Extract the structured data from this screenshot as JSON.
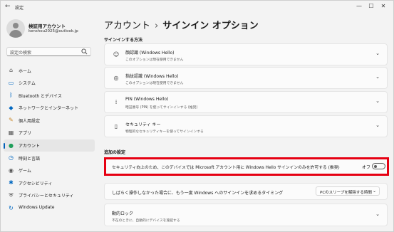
{
  "titlebar": {
    "back": "←",
    "title": "設定",
    "minimize": "—",
    "maximize": "☐",
    "close": "✕"
  },
  "profile": {
    "name": "検証用アカウント",
    "email": "kenshou2025@outlook.jp"
  },
  "search": {
    "placeholder": "設定の検索"
  },
  "nav": [
    {
      "label": "ホーム",
      "icon": "home-icon",
      "glyph": "⌂",
      "color": "#555555"
    },
    {
      "label": "システム",
      "icon": "monitor-icon",
      "glyph": "▭",
      "color": "#0067c0"
    },
    {
      "label": "Bluetooth とデバイス",
      "icon": "bluetooth-icon",
      "glyph": "ᛒ",
      "color": "#0067c0"
    },
    {
      "label": "ネットワークとインターネット",
      "icon": "wifi-icon",
      "glyph": "◆",
      "color": "#0067c0"
    },
    {
      "label": "個人用設定",
      "icon": "brush-icon",
      "glyph": "✎",
      "color": "#c98a2e"
    },
    {
      "label": "アプリ",
      "icon": "apps-icon",
      "glyph": "▦",
      "color": "#555555"
    },
    {
      "label": "アカウント",
      "icon": "account-icon",
      "glyph": "●",
      "color": "#1f9e5a"
    },
    {
      "label": "時刻と言語",
      "icon": "time-language-icon",
      "glyph": "◷",
      "color": "#0067c0"
    },
    {
      "label": "ゲーム",
      "icon": "game-icon",
      "glyph": "◉",
      "color": "#555555"
    },
    {
      "label": "アクセシビリティ",
      "icon": "accessibility-icon",
      "glyph": "✱",
      "color": "#0067c0"
    },
    {
      "label": "プライバシーとセキュリティ",
      "icon": "shield-icon",
      "glyph": "⛨",
      "color": "#555555"
    },
    {
      "label": "Windows Update",
      "icon": "update-icon",
      "glyph": "↻",
      "color": "#0067c0"
    }
  ],
  "active_nav": "アカウント",
  "header": {
    "parent": "アカウント",
    "separator": "›",
    "current": "サインイン オプション"
  },
  "signin": {
    "heading": "サインインする方法",
    "items": [
      {
        "title": "顔認識 (Windows Hello)",
        "subtitle": "このオプションは現在使用できません",
        "icon": "face-icon",
        "glyph": "☺"
      },
      {
        "title": "指紋認識 (Windows Hello)",
        "subtitle": "このオプションは現在使用できません",
        "icon": "fingerprint-icon",
        "glyph": "◎"
      },
      {
        "title": "PIN (Windows Hello)",
        "subtitle": "暗証番号 (PIN) を使ってサインインする (推奨)",
        "icon": "keypad-icon",
        "glyph": "⁞"
      },
      {
        "title": "セキュリティ キー",
        "subtitle": "物理的なセキュリティキーを使ってサインインする",
        "icon": "usb-key-icon",
        "glyph": "▯"
      }
    ]
  },
  "additional": {
    "heading": "追加の設定",
    "hello_only": {
      "label": "セキュリティ向上のため、このデバイスでは Microsoft アカウント用に Windows Hello サインインのみを許可する (推奨)",
      "state": "オフ"
    },
    "timeout": {
      "label": "しばらく操作しなかった場合に、もう一度 Windows へのサインインを求めるタイミング",
      "value": "PCのスリープを解除する時間"
    },
    "dynamic_lock": {
      "title": "動的ロック",
      "subtitle": "不在のときに、自動的にデバイスを施錠する"
    }
  },
  "chevron": "⌄",
  "accent_color": "#005fb8",
  "highlight_color": "#e60012"
}
